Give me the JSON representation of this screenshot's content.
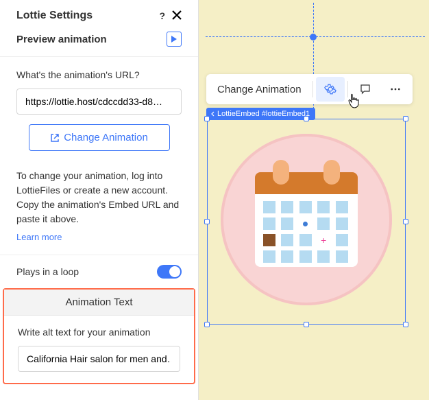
{
  "panel": {
    "title": "Lottie Settings",
    "preview_label": "Preview animation",
    "url_label": "What's the animation's URL?",
    "url_value": "https://lottie.host/cdccdd33-d8…",
    "change_btn": "Change Animation",
    "helper": "To change your animation, log into LottieFiles or create a new account. Copy the animation's Embed URL and paste it above.",
    "learn_more": "Learn more",
    "loop_label": "Plays in a loop",
    "anim_text_header": "Animation Text",
    "alt_label": "Write alt text for your animation",
    "alt_value": "California Hair salon for men and…"
  },
  "toolbar": {
    "change_animation": "Change Animation"
  },
  "embed_tag": "LottieEmbed #lottieEmbed1"
}
